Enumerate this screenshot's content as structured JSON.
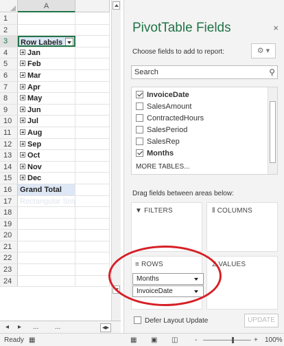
{
  "spreadsheet": {
    "column_a_label": "A",
    "rows": [
      {
        "num": "1",
        "a": "",
        "kind": "blank"
      },
      {
        "num": "2",
        "a": "",
        "kind": "blank"
      },
      {
        "num": "3",
        "a": "Row Labels",
        "kind": "header"
      },
      {
        "num": "4",
        "a": "Jan",
        "kind": "month"
      },
      {
        "num": "5",
        "a": "Feb",
        "kind": "month"
      },
      {
        "num": "6",
        "a": "Mar",
        "kind": "month"
      },
      {
        "num": "7",
        "a": "Apr",
        "kind": "month"
      },
      {
        "num": "8",
        "a": "May",
        "kind": "month"
      },
      {
        "num": "9",
        "a": "Jun",
        "kind": "month"
      },
      {
        "num": "10",
        "a": "Jul",
        "kind": "month"
      },
      {
        "num": "11",
        "a": "Aug",
        "kind": "month"
      },
      {
        "num": "12",
        "a": "Sep",
        "kind": "month"
      },
      {
        "num": "13",
        "a": "Oct",
        "kind": "month"
      },
      {
        "num": "14",
        "a": "Nov",
        "kind": "month"
      },
      {
        "num": "15",
        "a": "Dec",
        "kind": "month"
      },
      {
        "num": "16",
        "a": "Grand Total",
        "kind": "total"
      },
      {
        "num": "17",
        "a": "Rectangular Snip",
        "kind": "faded"
      },
      {
        "num": "18",
        "a": "",
        "kind": "blank"
      },
      {
        "num": "19",
        "a": "",
        "kind": "blank"
      },
      {
        "num": "20",
        "a": "",
        "kind": "blank"
      },
      {
        "num": "21",
        "a": "",
        "kind": "blank"
      },
      {
        "num": "22",
        "a": "",
        "kind": "blank"
      },
      {
        "num": "23",
        "a": "",
        "kind": "blank"
      },
      {
        "num": "24",
        "a": "",
        "kind": "blank"
      }
    ],
    "sheet_nav": {
      "ellipsis": "...",
      "ellipsis2": "..."
    }
  },
  "status_bar": {
    "ready": "Ready",
    "zoom": "100%",
    "minus": "-",
    "plus": "+"
  },
  "pivot_pane": {
    "title": "PivotTable Fields",
    "close": "× ",
    "choose_label": "Choose fields to add to report:",
    "gear": "⚙ ▾",
    "search_placeholder": "Search",
    "fields": [
      {
        "label": "InvoiceDate",
        "checked": true
      },
      {
        "label": "SalesAmount",
        "checked": false
      },
      {
        "label": "ContractedHours",
        "checked": false
      },
      {
        "label": "SalesPeriod",
        "checked": false
      },
      {
        "label": "SalesRep",
        "checked": false
      },
      {
        "label": "Months",
        "checked": true
      }
    ],
    "more_tables": "MORE TABLES...",
    "drag_label": "Drag fields between areas below:",
    "areas": {
      "filters": "FILTERS",
      "columns": "COLUMNS",
      "rows": "ROWS",
      "values": "VALUES"
    },
    "row_fields": [
      "Months",
      "InvoiceDate"
    ],
    "defer_label": "Defer Layout Update",
    "update_label": "UPDATE"
  },
  "accent_color": "#217346",
  "annotation_color": "#d61f26"
}
